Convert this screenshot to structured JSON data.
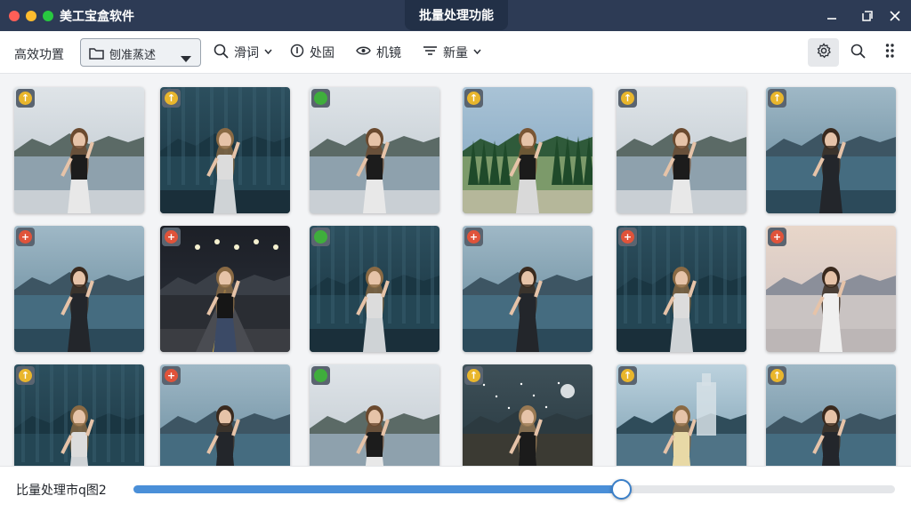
{
  "window": {
    "title": "美工宝盒软件",
    "center_title": "批量处理功能",
    "traffic_colors": [
      "#ff5f57",
      "#febc2e",
      "#28c840"
    ]
  },
  "toolbar": {
    "left_label": "高效功置",
    "dropdown_value": "刨准蒸述",
    "items": [
      {
        "label": "滑词",
        "icon": "search-icon",
        "has_chevron": true
      },
      {
        "label": "处固",
        "icon": "info-icon",
        "has_chevron": false
      },
      {
        "label": "机镜",
        "icon": "eye-icon",
        "has_chevron": false
      },
      {
        "label": "新量",
        "icon": "filter-icon",
        "has_chevron": true
      }
    ]
  },
  "grid": {
    "badge_colors": {
      "yellow": "#e9b62c",
      "red": "#e0533a",
      "green": "#3fae3c"
    },
    "thumbnails": [
      {
        "scene": "lake",
        "badge": "yellow",
        "glyph": "↑"
      },
      {
        "scene": "forest",
        "badge": "yellow",
        "glyph": "↑"
      },
      {
        "scene": "lake",
        "badge": "green",
        "glyph": ""
      },
      {
        "scene": "valley",
        "badge": "yellow",
        "glyph": "↑"
      },
      {
        "scene": "lake",
        "badge": "yellow",
        "glyph": "↑"
      },
      {
        "scene": "lake-teal",
        "badge": "yellow",
        "glyph": "↑"
      },
      {
        "scene": "lake-teal",
        "badge": "red",
        "glyph": "+"
      },
      {
        "scene": "road",
        "badge": "red",
        "glyph": "+"
      },
      {
        "scene": "forest",
        "badge": "green",
        "glyph": ""
      },
      {
        "scene": "lake-teal",
        "badge": "red",
        "glyph": "+"
      },
      {
        "scene": "forest",
        "badge": "red",
        "glyph": "+"
      },
      {
        "scene": "sunset",
        "badge": "red",
        "glyph": "+"
      },
      {
        "scene": "forest",
        "badge": "yellow",
        "glyph": "↑"
      },
      {
        "scene": "lake-teal",
        "badge": "red",
        "glyph": "+"
      },
      {
        "scene": "lake",
        "badge": "green",
        "glyph": ""
      },
      {
        "scene": "night",
        "badge": "yellow",
        "glyph": "↑"
      },
      {
        "scene": "castle",
        "badge": "yellow",
        "glyph": "↑"
      },
      {
        "scene": "lake-teal",
        "badge": "yellow",
        "glyph": "↑"
      }
    ]
  },
  "status": {
    "label": "比量处理市q图2",
    "progress": 0.64
  }
}
